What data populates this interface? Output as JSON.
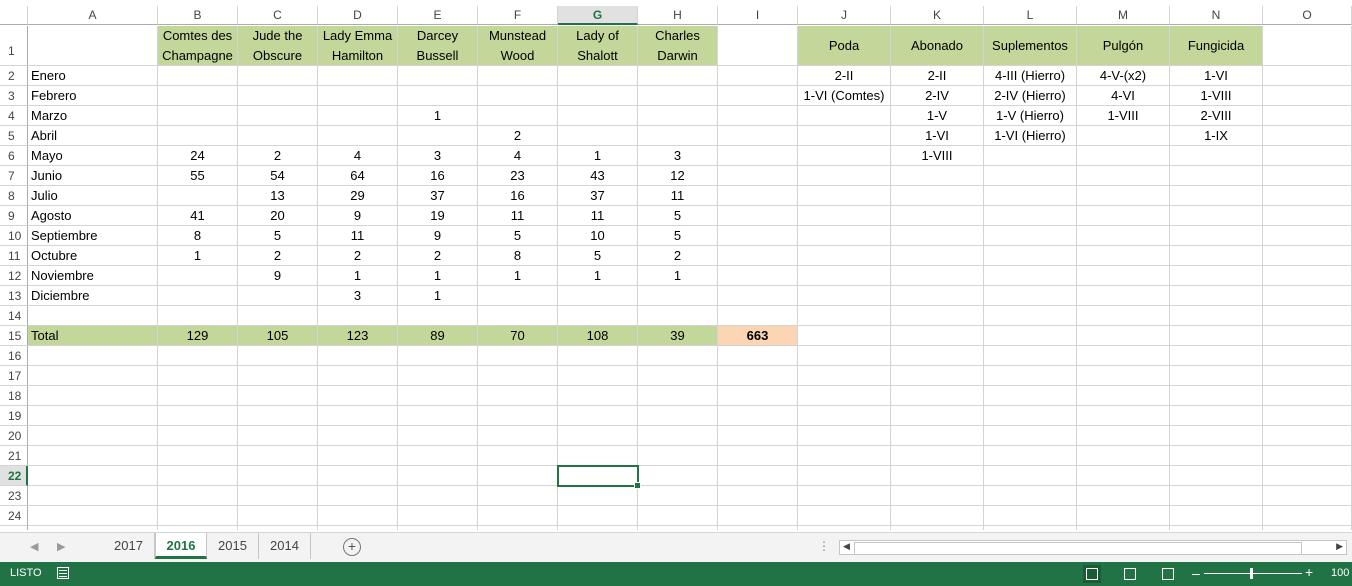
{
  "columns": [
    "A",
    "B",
    "C",
    "D",
    "E",
    "F",
    "G",
    "H",
    "I",
    "J",
    "K",
    "L",
    "M",
    "N",
    "O"
  ],
  "selected_column": "G",
  "selected_row": "22",
  "headers": {
    "B": [
      "Comtes des",
      "Champagne"
    ],
    "C": [
      "Jude the",
      "Obscure"
    ],
    "D": [
      "Lady Emma",
      "Hamilton"
    ],
    "E": [
      "Darcey",
      "Bussell"
    ],
    "F": [
      "Munstead",
      "Wood"
    ],
    "G": [
      "Lady of",
      "Shalott"
    ],
    "H": [
      "Charles",
      "Darwin"
    ],
    "J": "Poda",
    "K": "Abonado",
    "L": "Suplementos",
    "M": "Pulgón",
    "N": "Fungicida"
  },
  "months": [
    "Enero",
    "Febrero",
    "Marzo",
    "Abril",
    "Mayo",
    "Junio",
    "Julio",
    "Agosto",
    "Septiembre",
    "Octubre",
    "Noviembre",
    "Diciembre"
  ],
  "month_values": [
    [
      "",
      "",
      "",
      "",
      "",
      "",
      ""
    ],
    [
      "",
      "",
      "",
      "",
      "",
      "",
      ""
    ],
    [
      "",
      "",
      "",
      "1",
      "",
      "",
      ""
    ],
    [
      "",
      "",
      "",
      "",
      "2",
      "",
      ""
    ],
    [
      "24",
      "2",
      "4",
      "3",
      "4",
      "1",
      "3"
    ],
    [
      "55",
      "54",
      "64",
      "16",
      "23",
      "43",
      "12"
    ],
    [
      "",
      "13",
      "29",
      "37",
      "16",
      "37",
      "11"
    ],
    [
      "41",
      "20",
      "9",
      "19",
      "11",
      "11",
      "5"
    ],
    [
      "8",
      "5",
      "11",
      "9",
      "5",
      "10",
      "5"
    ],
    [
      "1",
      "2",
      "2",
      "2",
      "8",
      "5",
      "2"
    ],
    [
      "",
      "9",
      "1",
      "1",
      "1",
      "1",
      "1"
    ],
    [
      "",
      "",
      "3",
      "1",
      "",
      "",
      ""
    ]
  ],
  "tasks": {
    "J": [
      "2-II",
      "1-VI (Comtes)",
      "",
      "",
      "",
      ""
    ],
    "K": [
      "2-II",
      "2-IV",
      "1-V",
      "1-VI",
      "1-VIII"
    ],
    "L": [
      "4-III (Hierro)",
      "2-IV (Hierro)",
      "1-V (Hierro)",
      "1-VI (Hierro)"
    ],
    "M": [
      "4-V-(x2)",
      "4-VI",
      "1-VIII"
    ],
    "N": [
      "1-VI",
      "1-VIII",
      "2-VIII",
      "1-IX"
    ]
  },
  "total_label": "Total",
  "totals": [
    "129",
    "105",
    "123",
    "89",
    "70",
    "108",
    "39"
  ],
  "grand_total": "663",
  "colors": {
    "header_green": "#c4d79b",
    "total_orange": "#fcd5b4",
    "excel_green": "#217346"
  },
  "sheet_tabs": [
    {
      "label": "2017",
      "active": false
    },
    {
      "label": "2016",
      "active": true
    },
    {
      "label": "2015",
      "active": false
    },
    {
      "label": "2014",
      "active": false
    }
  ],
  "add_sheet_symbol": "+",
  "status": {
    "text": "LISTO",
    "zoom": "100"
  }
}
